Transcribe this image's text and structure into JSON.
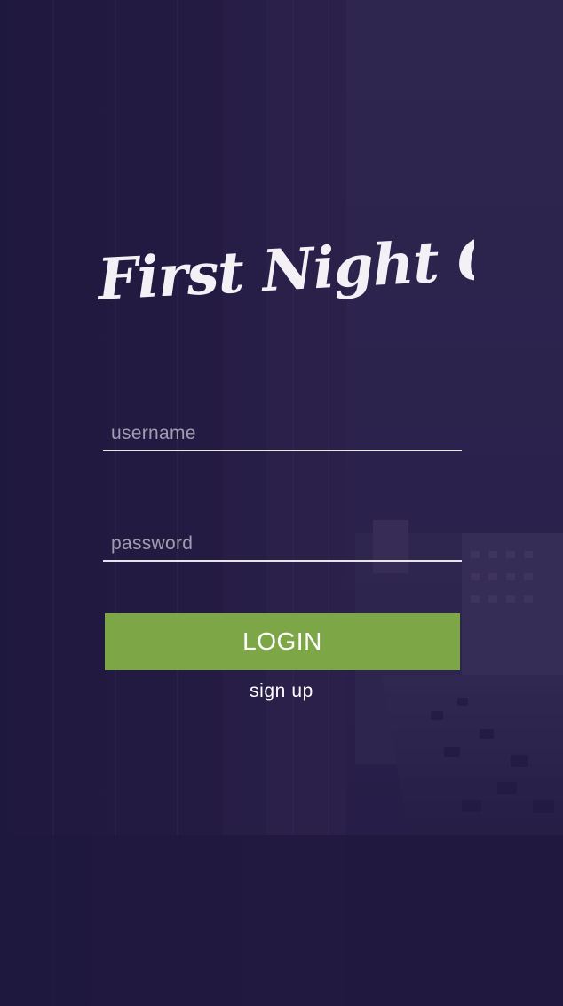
{
  "app": {
    "logo_text": "First Night Out"
  },
  "form": {
    "username_placeholder": "username",
    "username_value": "",
    "password_placeholder": "password",
    "password_value": "",
    "login_label": "LOGIN",
    "signup_label": "sign up"
  },
  "colors": {
    "background": "#251d46",
    "overlay": "#241a48",
    "accent_button": "#7da647",
    "text": "#ffffff",
    "placeholder": "#a19cae",
    "underline": "#e6e3ea"
  }
}
